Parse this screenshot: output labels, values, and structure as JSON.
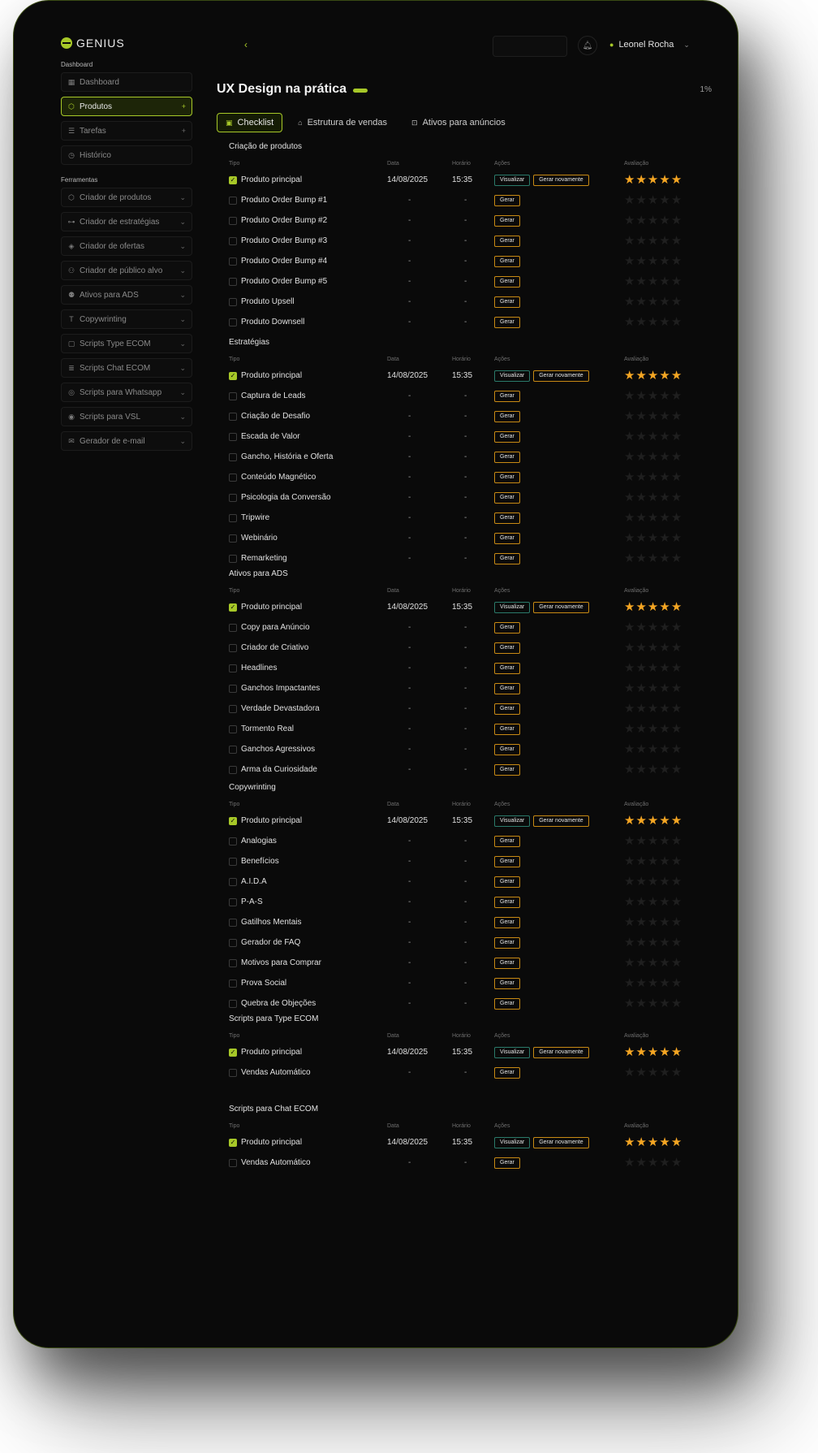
{
  "app": {
    "logo": "GENIUS"
  },
  "sidebar": {
    "section_main": "Dashboard",
    "main_items": [
      {
        "label": "Dashboard",
        "icon": "grid-icon",
        "glyph": "▦",
        "trail": ""
      },
      {
        "label": "Produtos",
        "icon": "box-icon",
        "glyph": "⬡",
        "trail": "+",
        "active": true
      },
      {
        "label": "Tarefas",
        "icon": "list-icon",
        "glyph": "☰",
        "trail": "+"
      },
      {
        "label": "Histórico",
        "icon": "clock-icon",
        "glyph": "◷",
        "trail": ""
      }
    ],
    "section_tools": "Ferramentas",
    "tool_items": [
      {
        "label": "Criador de produtos",
        "icon": "box-icon",
        "glyph": "⬡"
      },
      {
        "label": "Criador de estratégias",
        "icon": "flow-icon",
        "glyph": "⊶"
      },
      {
        "label": "Criador de ofertas",
        "icon": "tag-icon",
        "glyph": "◈"
      },
      {
        "label": "Criador de público alvo",
        "icon": "user-icon",
        "glyph": "⚇"
      },
      {
        "label": "Ativos para ADS",
        "icon": "users-icon",
        "glyph": "⚉"
      },
      {
        "label": "Copywrinting",
        "icon": "text-icon",
        "glyph": "T"
      },
      {
        "label": "Scripts Type ECOM",
        "icon": "square-icon",
        "glyph": "▢"
      },
      {
        "label": "Scripts Chat ECOM",
        "icon": "chat-icon",
        "glyph": "≣"
      },
      {
        "label": "Scripts para Whatsapp",
        "icon": "whatsapp-icon",
        "glyph": "◎"
      },
      {
        "label": "Scripts para VSL",
        "icon": "play-icon",
        "glyph": "◉"
      },
      {
        "label": "Gerador de e-mail",
        "icon": "mail-icon",
        "glyph": "✉"
      }
    ]
  },
  "topbar": {
    "user_name": "Leonel Rocha"
  },
  "page": {
    "title": "UX Design na prática",
    "progress": "1%",
    "tabs": [
      {
        "label": "Checklist",
        "icon": "clipboard-icon",
        "glyph": "▣",
        "active": true
      },
      {
        "label": "Estrutura de vendas",
        "icon": "store-icon",
        "glyph": "⌂"
      },
      {
        "label": "Ativos para anúncios",
        "icon": "lock-icon",
        "glyph": "⊡"
      }
    ]
  },
  "table_headers": {
    "tipo": "Tipo",
    "data": "Data",
    "horario": "Horário",
    "acoes": "Ações",
    "avaliacao": "Avaliação"
  },
  "actions": {
    "view": "Visualizar",
    "regen": "Gerar novamente",
    "gen": "Gerar"
  },
  "sections": [
    {
      "title": "Criação de produtos",
      "rows": [
        {
          "tipo": "Produto principal",
          "done": true,
          "data": "14/08/2025",
          "horario": "15:35",
          "rating": 5
        },
        {
          "tipo": "Produto Order Bump #1",
          "done": false,
          "data": "-",
          "horario": "-",
          "rating": 0
        },
        {
          "tipo": "Produto Order Bump #2",
          "done": false,
          "data": "-",
          "horario": "-",
          "rating": 0
        },
        {
          "tipo": "Produto Order Bump #3",
          "done": false,
          "data": "-",
          "horario": "-",
          "rating": 0
        },
        {
          "tipo": "Produto Order Bump #4",
          "done": false,
          "data": "-",
          "horario": "-",
          "rating": 0
        },
        {
          "tipo": "Produto Order Bump #5",
          "done": false,
          "data": "-",
          "horario": "-",
          "rating": 0
        },
        {
          "tipo": "Produto Upsell",
          "done": false,
          "data": "-",
          "horario": "-",
          "rating": 0
        },
        {
          "tipo": "Produto Downsell",
          "done": false,
          "data": "-",
          "horario": "-",
          "rating": 0
        }
      ]
    },
    {
      "title": "Estratégias",
      "rows": [
        {
          "tipo": "Produto principal",
          "done": true,
          "data": "14/08/2025",
          "horario": "15:35",
          "rating": 5
        },
        {
          "tipo": "Captura de Leads",
          "done": false,
          "data": "-",
          "horario": "-",
          "rating": 0
        },
        {
          "tipo": "Criação de Desafio",
          "done": false,
          "data": "-",
          "horario": "-",
          "rating": 0
        },
        {
          "tipo": "Escada de Valor",
          "done": false,
          "data": "-",
          "horario": "-",
          "rating": 0
        },
        {
          "tipo": "Gancho, História e Oferta",
          "done": false,
          "data": "-",
          "horario": "-",
          "rating": 0
        },
        {
          "tipo": "Conteúdo Magnético",
          "done": false,
          "data": "-",
          "horario": "-",
          "rating": 0
        },
        {
          "tipo": "Psicologia da Conversão",
          "done": false,
          "data": "-",
          "horario": "-",
          "rating": 0
        },
        {
          "tipo": "Tripwire",
          "done": false,
          "data": "-",
          "horario": "-",
          "rating": 0
        },
        {
          "tipo": "Webinário",
          "done": false,
          "data": "-",
          "horario": "-",
          "rating": 0
        },
        {
          "tipo": "Remarketing",
          "done": false,
          "data": "-",
          "horario": "-",
          "rating": 0
        }
      ]
    },
    {
      "title": "Ativos para ADS",
      "rows": [
        {
          "tipo": "Produto principal",
          "done": true,
          "data": "14/08/2025",
          "horario": "15:35",
          "rating": 5
        },
        {
          "tipo": "Copy para Anúncio",
          "done": false,
          "data": "-",
          "horario": "-",
          "rating": 0
        },
        {
          "tipo": "Criador de Criativo",
          "done": false,
          "data": "-",
          "horario": "-",
          "rating": 0
        },
        {
          "tipo": "Headlines",
          "done": false,
          "data": "-",
          "horario": "-",
          "rating": 0
        },
        {
          "tipo": "Ganchos Impactantes",
          "done": false,
          "data": "-",
          "horario": "-",
          "rating": 0
        },
        {
          "tipo": "Verdade Devastadora",
          "done": false,
          "data": "-",
          "horario": "-",
          "rating": 0
        },
        {
          "tipo": "Tormento Real",
          "done": false,
          "data": "-",
          "horario": "-",
          "rating": 0
        },
        {
          "tipo": "Ganchos Agressivos",
          "done": false,
          "data": "-",
          "horario": "-",
          "rating": 0
        },
        {
          "tipo": "Arma da Curiosidade",
          "done": false,
          "data": "-",
          "horario": "-",
          "rating": 0
        }
      ]
    },
    {
      "title": "Copywrinting",
      "rows": [
        {
          "tipo": "Produto principal",
          "done": true,
          "data": "14/08/2025",
          "horario": "15:35",
          "rating": 5
        },
        {
          "tipo": "Analogias",
          "done": false,
          "data": "-",
          "horario": "-",
          "rating": 0
        },
        {
          "tipo": "Benefícios",
          "done": false,
          "data": "-",
          "horario": "-",
          "rating": 0
        },
        {
          "tipo": "A.I.D.A",
          "done": false,
          "data": "-",
          "horario": "-",
          "rating": 0
        },
        {
          "tipo": "P-A-S",
          "done": false,
          "data": "-",
          "horario": "-",
          "rating": 0
        },
        {
          "tipo": "Gatilhos Mentais",
          "done": false,
          "data": "-",
          "horario": "-",
          "rating": 0
        },
        {
          "tipo": "Gerador de FAQ",
          "done": false,
          "data": "-",
          "horario": "-",
          "rating": 0
        },
        {
          "tipo": "Motivos para Comprar",
          "done": false,
          "data": "-",
          "horario": "-",
          "rating": 0
        },
        {
          "tipo": "Prova Social",
          "done": false,
          "data": "-",
          "horario": "-",
          "rating": 0
        },
        {
          "tipo": "Quebra de Objeções",
          "done": false,
          "data": "-",
          "horario": "-",
          "rating": 0
        }
      ]
    },
    {
      "title": "Scripts para Type ECOM",
      "rows": [
        {
          "tipo": "Produto principal",
          "done": true,
          "data": "14/08/2025",
          "horario": "15:35",
          "rating": 5
        },
        {
          "tipo": "Vendas Automático",
          "done": false,
          "data": "-",
          "horario": "-",
          "rating": 0
        }
      ]
    },
    {
      "title": "Scripts para Chat ECOM",
      "rows": [
        {
          "tipo": "Produto principal",
          "done": true,
          "data": "14/08/2025",
          "horario": "15:35",
          "rating": 5
        },
        {
          "tipo": "Vendas Automático",
          "done": false,
          "data": "-",
          "horario": "-",
          "rating": 0
        }
      ]
    }
  ]
}
